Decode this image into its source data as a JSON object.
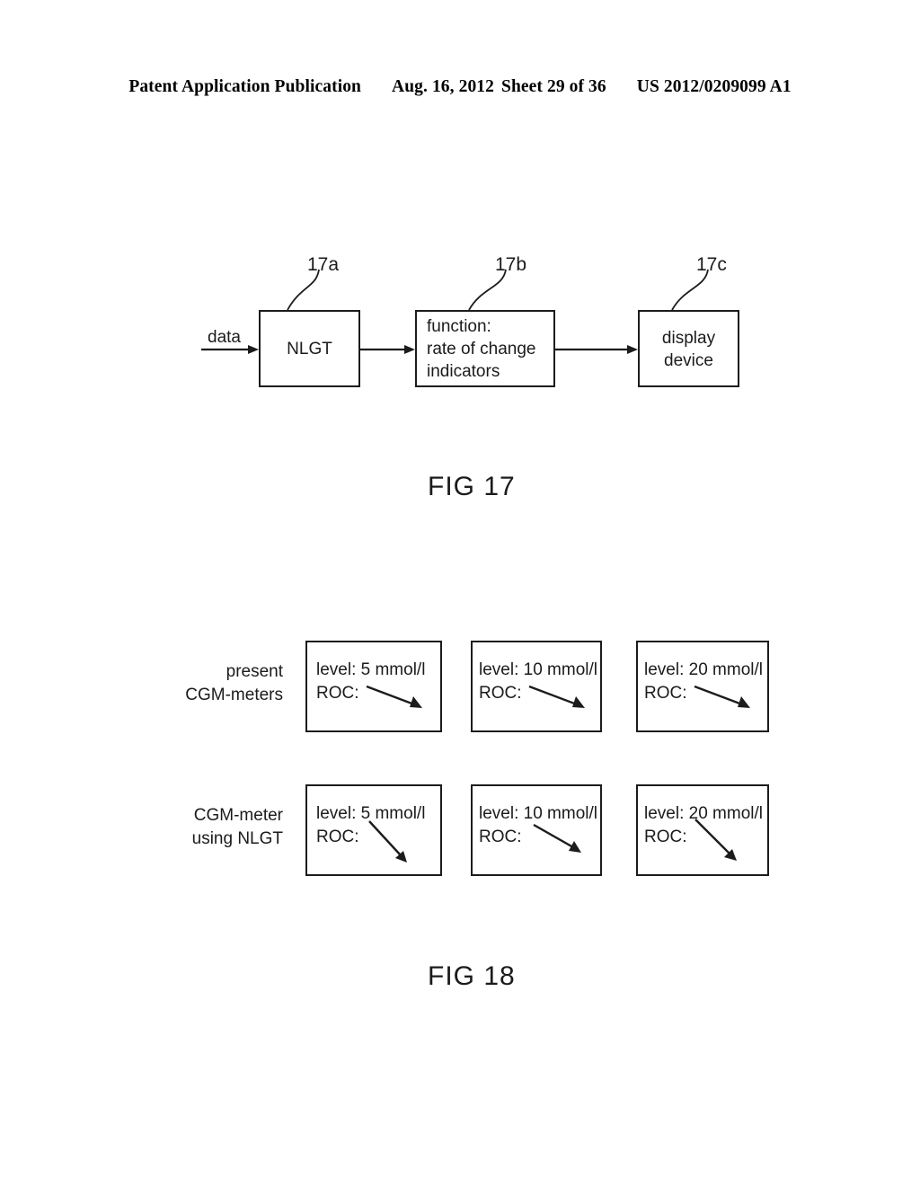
{
  "header": {
    "publication": "Patent Application Publication",
    "date": "Aug. 16, 2012",
    "sheet": "Sheet 29 of 36",
    "document_number": "US 2012/0209099 A1"
  },
  "figures": [
    {
      "caption": "FIG 17",
      "input_label": "data",
      "blocks": [
        {
          "ref": "17a",
          "lines": [
            "NLGT"
          ],
          "align": "center"
        },
        {
          "ref": "17b",
          "lines": [
            "function:",
            "rate of change",
            "indicators"
          ],
          "align": "left"
        },
        {
          "ref": "17c",
          "lines": [
            "display",
            "device"
          ],
          "align": "center"
        }
      ]
    },
    {
      "caption": "FIG 18",
      "rows": [
        {
          "label_lines": [
            "present",
            "CGM-meters"
          ],
          "cells": [
            {
              "level_text": "level: 5 mmol/l",
              "roc_text": "ROC:",
              "roc_angle_deg": 20
            },
            {
              "level_text": "level: 10 mmol/l",
              "roc_text": "ROC:",
              "roc_angle_deg": 20
            },
            {
              "level_text": "level: 20 mmol/l",
              "roc_text": "ROC:",
              "roc_angle_deg": 20
            }
          ]
        },
        {
          "label_lines": [
            "CGM-meter",
            "using NLGT"
          ],
          "cells": [
            {
              "level_text": "level: 5 mmol/l",
              "roc_text": "ROC:",
              "roc_angle_deg": 48
            },
            {
              "level_text": "level: 10 mmol/l",
              "roc_text": "ROC:",
              "roc_angle_deg": 30
            },
            {
              "level_text": "level: 20 mmol/l",
              "roc_text": "ROC:",
              "roc_angle_deg": 55
            }
          ]
        }
      ]
    }
  ],
  "colors": {
    "ink": "#1c1c1c",
    "paper": "#ffffff"
  }
}
